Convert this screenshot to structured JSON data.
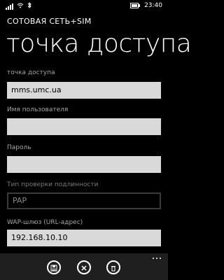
{
  "status_bar": {
    "time": "23:40",
    "icons": [
      "signal-icon",
      "wifi-icon",
      "bluetooth-icon",
      "battery-icon"
    ]
  },
  "header": {
    "app_title": "СОТОВАЯ СЕТЬ+SIM",
    "page_title": "точка доступа"
  },
  "form": {
    "fields": [
      {
        "label": "точка доступа",
        "value": "mms.umc.ua",
        "disabled": false
      },
      {
        "label": "Имя пользователя",
        "value": "",
        "disabled": false
      },
      {
        "label": "Пароль",
        "value": "",
        "disabled": false
      },
      {
        "label": "Тип проверки подлинности",
        "value": "PAP",
        "disabled": true
      },
      {
        "label": "WAP-шлюз (URL-адрес)",
        "value": "192.168.10.10",
        "disabled": false
      }
    ]
  },
  "app_bar": {
    "buttons": [
      {
        "icon": "save-icon"
      },
      {
        "icon": "cancel-icon"
      },
      {
        "icon": "delete-icon"
      }
    ],
    "more_icon": "more-icon"
  }
}
